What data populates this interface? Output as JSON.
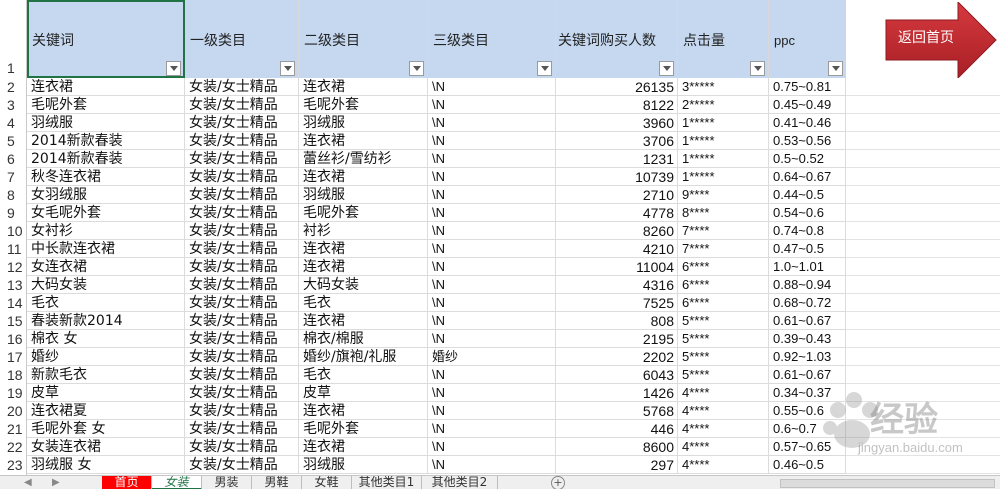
{
  "header": {
    "row_num": "1",
    "columns": [
      "关键词",
      "一级类目",
      "二级类目",
      "三级类目",
      "关键词购买人数",
      "点击量",
      "ppc"
    ]
  },
  "home_button": {
    "label": "返回首页",
    "color": "#c0282e"
  },
  "rows": [
    {
      "n": "2",
      "kw": "连衣裙",
      "c1": "女装/女士精品",
      "c2": "连衣裙",
      "c3": "\\N",
      "buyers": "26135",
      "clicks": "3*****",
      "ppc": "0.75~0.81"
    },
    {
      "n": "3",
      "kw": "毛呢外套",
      "c1": "女装/女士精品",
      "c2": "毛呢外套",
      "c3": "\\N",
      "buyers": "8122",
      "clicks": "2*****",
      "ppc": "0.45~0.49"
    },
    {
      "n": "4",
      "kw": "羽绒服",
      "c1": "女装/女士精品",
      "c2": "羽绒服",
      "c3": "\\N",
      "buyers": "3960",
      "clicks": "1*****",
      "ppc": "0.41~0.46"
    },
    {
      "n": "5",
      "kw": "2014新款春装",
      "c1": "女装/女士精品",
      "c2": "连衣裙",
      "c3": "\\N",
      "buyers": "3706",
      "clicks": "1*****",
      "ppc": "0.53~0.56"
    },
    {
      "n": "6",
      "kw": "2014新款春装",
      "c1": "女装/女士精品",
      "c2": "蕾丝衫/雪纺衫",
      "c3": "\\N",
      "buyers": "1231",
      "clicks": "1*****",
      "ppc": "0.5~0.52"
    },
    {
      "n": "7",
      "kw": "秋冬连衣裙",
      "c1": "女装/女士精品",
      "c2": "连衣裙",
      "c3": "\\N",
      "buyers": "10739",
      "clicks": "1*****",
      "ppc": "0.64~0.67"
    },
    {
      "n": "8",
      "kw": "女羽绒服",
      "c1": "女装/女士精品",
      "c2": "羽绒服",
      "c3": "\\N",
      "buyers": "2710",
      "clicks": "9****",
      "ppc": "0.44~0.5"
    },
    {
      "n": "9",
      "kw": "女毛呢外套",
      "c1": "女装/女士精品",
      "c2": "毛呢外套",
      "c3": "\\N",
      "buyers": "4778",
      "clicks": "8****",
      "ppc": "0.54~0.6"
    },
    {
      "n": "10",
      "kw": "女衬衫",
      "c1": "女装/女士精品",
      "c2": "衬衫",
      "c3": "\\N",
      "buyers": "8260",
      "clicks": "7****",
      "ppc": "0.74~0.8"
    },
    {
      "n": "11",
      "kw": "中长款连衣裙",
      "c1": "女装/女士精品",
      "c2": "连衣裙",
      "c3": "\\N",
      "buyers": "4210",
      "clicks": "7****",
      "ppc": "0.47~0.5"
    },
    {
      "n": "12",
      "kw": "女连衣裙",
      "c1": "女装/女士精品",
      "c2": "连衣裙",
      "c3": "\\N",
      "buyers": "11004",
      "clicks": "6****",
      "ppc": "1.0~1.01"
    },
    {
      "n": "13",
      "kw": "大码女装",
      "c1": "女装/女士精品",
      "c2": "大码女装",
      "c3": "\\N",
      "buyers": "4316",
      "clicks": "6****",
      "ppc": "0.88~0.94"
    },
    {
      "n": "14",
      "kw": "毛衣",
      "c1": "女装/女士精品",
      "c2": "毛衣",
      "c3": "\\N",
      "buyers": "7525",
      "clicks": "6****",
      "ppc": "0.68~0.72"
    },
    {
      "n": "15",
      "kw": "春装新款2014",
      "c1": "女装/女士精品",
      "c2": "连衣裙",
      "c3": "\\N",
      "buyers": "808",
      "clicks": "5****",
      "ppc": "0.61~0.67"
    },
    {
      "n": "16",
      "kw": "棉衣 女",
      "c1": "女装/女士精品",
      "c2": "棉衣/棉服",
      "c3": "\\N",
      "buyers": "2195",
      "clicks": "5****",
      "ppc": "0.39~0.43"
    },
    {
      "n": "17",
      "kw": "婚纱",
      "c1": "女装/女士精品",
      "c2": "婚纱/旗袍/礼服",
      "c3": "婚纱",
      "buyers": "2202",
      "clicks": "5****",
      "ppc": "0.92~1.03"
    },
    {
      "n": "18",
      "kw": "新款毛衣",
      "c1": "女装/女士精品",
      "c2": "毛衣",
      "c3": "\\N",
      "buyers": "6043",
      "clicks": "5****",
      "ppc": "0.61~0.67"
    },
    {
      "n": "19",
      "kw": "皮草",
      "c1": "女装/女士精品",
      "c2": "皮草",
      "c3": "\\N",
      "buyers": "1426",
      "clicks": "4****",
      "ppc": "0.34~0.37"
    },
    {
      "n": "20",
      "kw": "连衣裙夏",
      "c1": "女装/女士精品",
      "c2": "连衣裙",
      "c3": "\\N",
      "buyers": "5768",
      "clicks": "4****",
      "ppc": "0.55~0.6"
    },
    {
      "n": "21",
      "kw": "毛呢外套 女",
      "c1": "女装/女士精品",
      "c2": "毛呢外套",
      "c3": "\\N",
      "buyers": "446",
      "clicks": "4****",
      "ppc": "0.6~0.7"
    },
    {
      "n": "22",
      "kw": "女装连衣裙",
      "c1": "女装/女士精品",
      "c2": "连衣裙",
      "c3": "\\N",
      "buyers": "8600",
      "clicks": "4****",
      "ppc": "0.57~0.65"
    },
    {
      "n": "23",
      "kw": "羽绒服 女",
      "c1": "女装/女士精品",
      "c2": "羽绒服",
      "c3": "\\N",
      "buyers": "297",
      "clicks": "4****",
      "ppc": "0.46~0.5"
    }
  ],
  "tabs": [
    {
      "label": "首页",
      "style": "red"
    },
    {
      "label": "女装",
      "style": "active"
    },
    {
      "label": "男装",
      "style": ""
    },
    {
      "label": "男鞋",
      "style": ""
    },
    {
      "label": "女鞋",
      "style": ""
    },
    {
      "label": "其他类目1",
      "style": ""
    },
    {
      "label": "其他类目2",
      "style": ""
    }
  ],
  "watermark": {
    "text": "经验",
    "url": "jingyan.baidu.com"
  }
}
